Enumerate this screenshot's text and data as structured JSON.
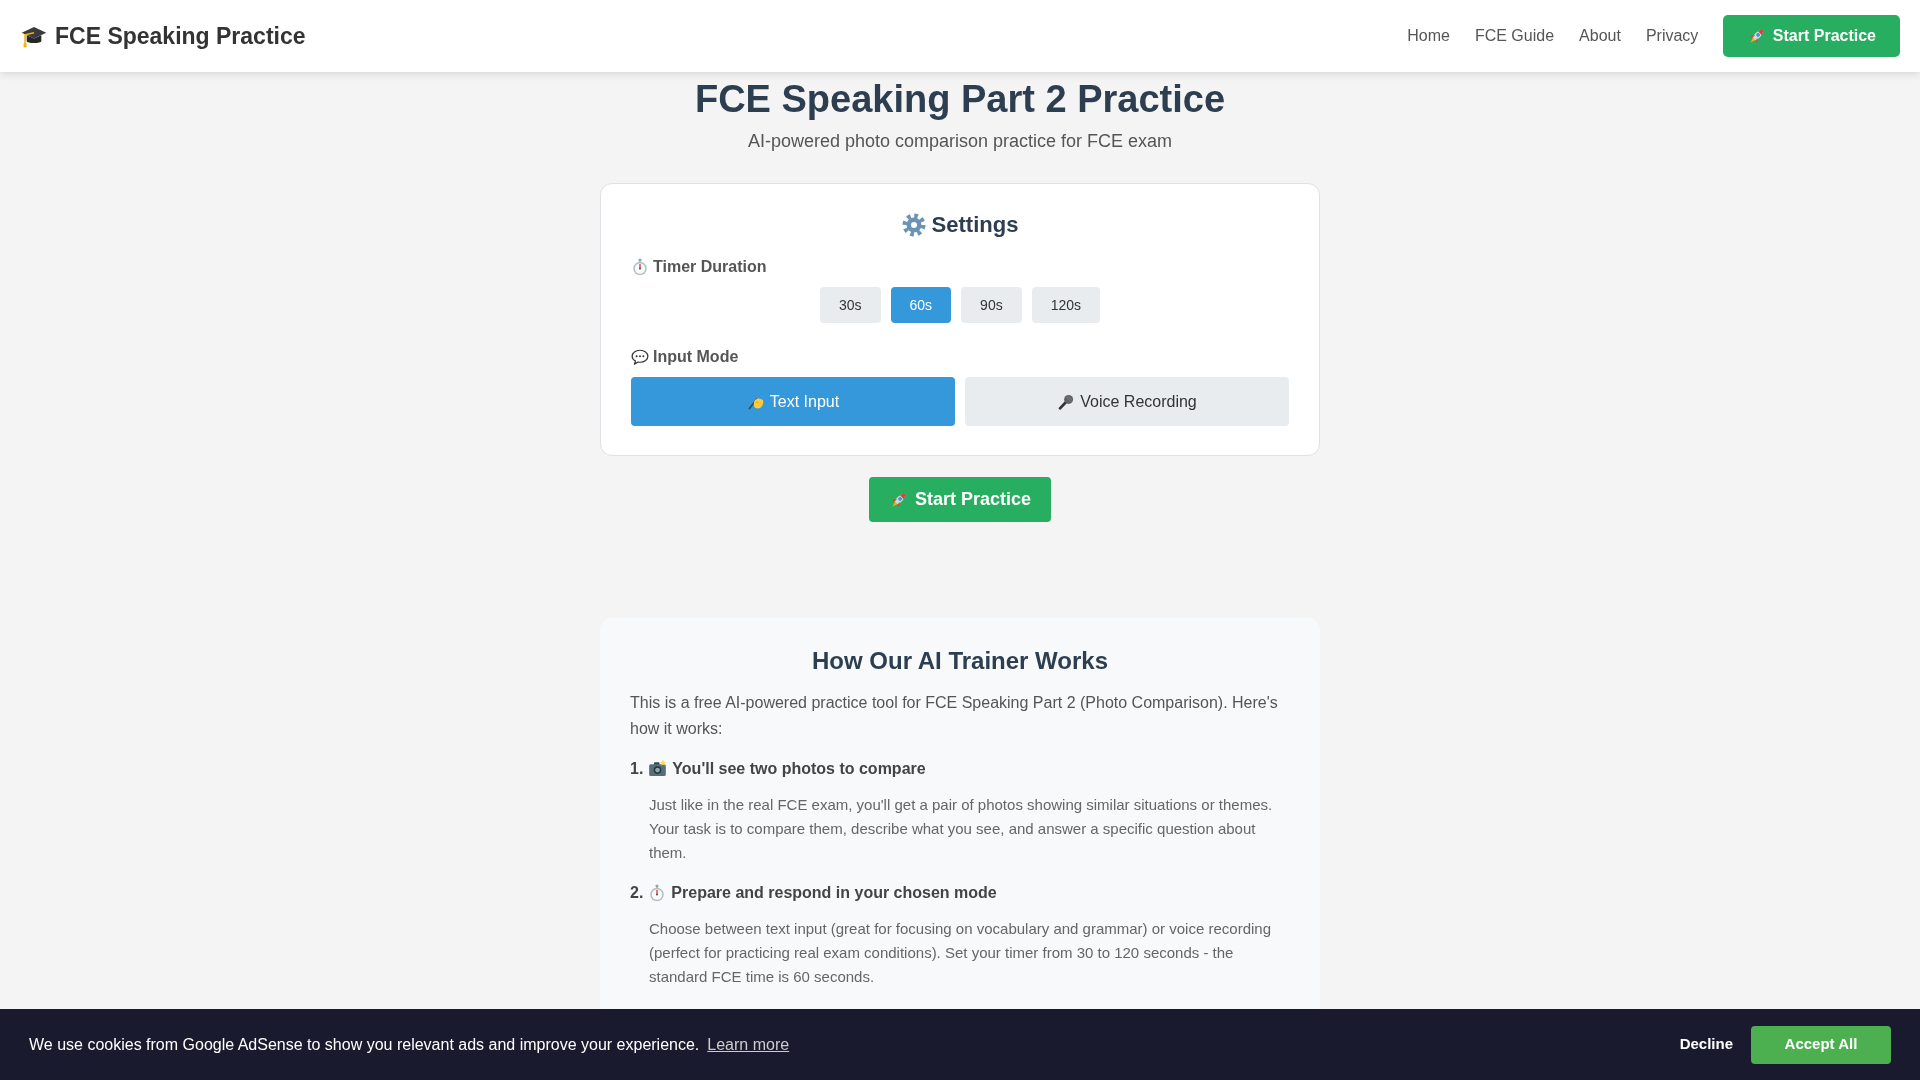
{
  "navbar": {
    "brand": "FCE Speaking Practice",
    "links": [
      "Home",
      "FCE Guide",
      "About",
      "Privacy"
    ],
    "cta": "Start Practice"
  },
  "header": {
    "title": "FCE Speaking Part 2 Practice",
    "subtitle": "AI-powered photo comparison practice for FCE exam"
  },
  "settings": {
    "title": "Settings",
    "timer": {
      "label": "Timer Duration",
      "options": [
        {
          "label": "30s",
          "selected": false
        },
        {
          "label": "60s",
          "selected": true
        },
        {
          "label": "90s",
          "selected": false
        },
        {
          "label": "120s",
          "selected": false
        }
      ]
    },
    "input_mode": {
      "label": "Input Mode",
      "options": [
        {
          "kind": "text",
          "label": "Text Input",
          "selected": true
        },
        {
          "kind": "voice",
          "label": "Voice Recording",
          "selected": false
        }
      ]
    }
  },
  "start_button": "Start Practice",
  "how_it_works": {
    "title": "How Our AI Trainer Works",
    "intro": "This is a free AI-powered practice tool for FCE Speaking Part 2 (Photo Comparison). Here's how it works:",
    "steps": [
      {
        "kind": "photos",
        "number": "1.",
        "title": "You'll see two photos to compare",
        "text": "Just like in the real FCE exam, you'll get a pair of photos showing similar situations or themes. Your task is to compare them, describe what you see, and answer a specific question about them."
      },
      {
        "kind": "timing",
        "number": "2.",
        "title": "Prepare and respond in your chosen mode",
        "text": "Choose between text input (great for focusing on vocabulary and grammar) or voice recording (perfect for practicing real exam conditions). Set your timer from 30 to 120 seconds - the standard FCE time is 60 seconds."
      }
    ]
  },
  "cookie_banner": {
    "text": "We use cookies from Google AdSense to show you relevant ads and improve your experience.",
    "link": "Learn more",
    "decline": "Decline",
    "accept": "Accept All"
  }
}
